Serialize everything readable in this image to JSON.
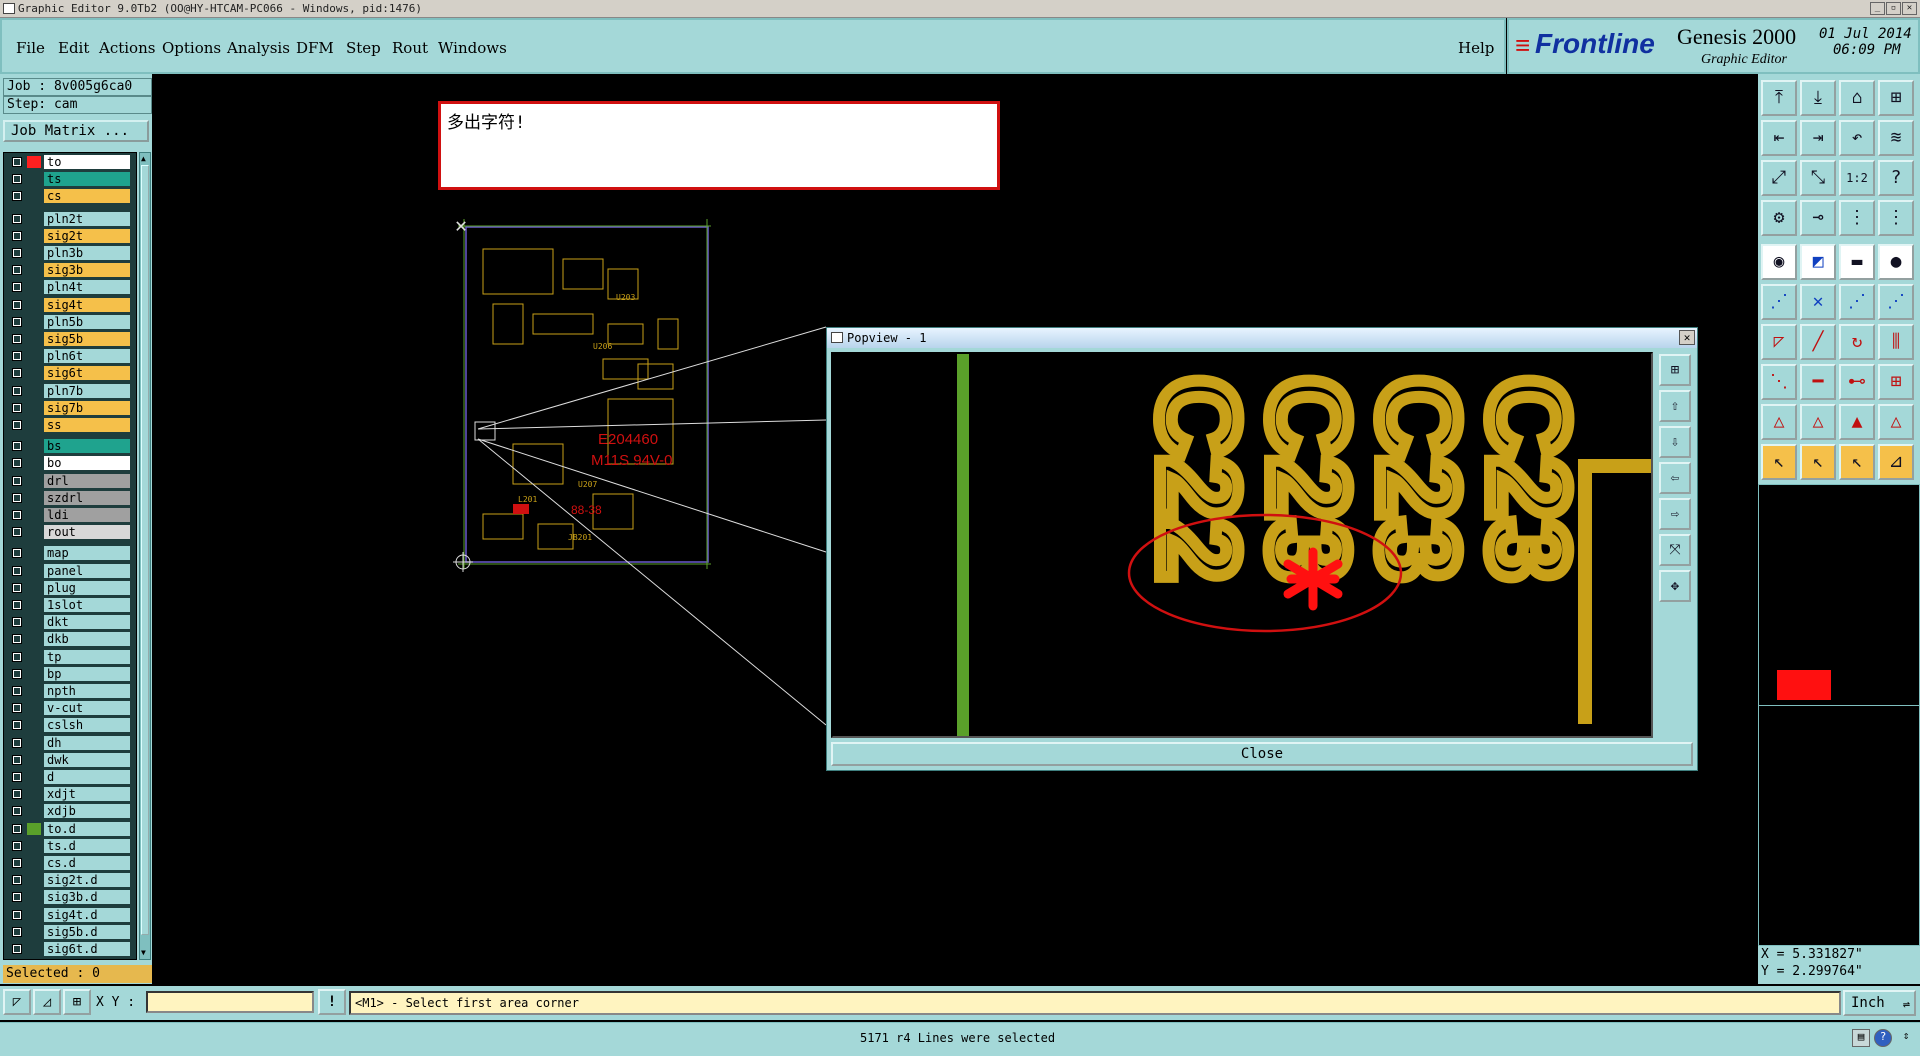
{
  "window": {
    "title": "Graphic Editor 9.0Tb2 (OO@HY-HTCAM-PC066 - Windows, pid:1476)",
    "controls": [
      "_",
      "▫",
      "✕"
    ]
  },
  "menu": {
    "items": [
      "File",
      "Edit",
      "Actions",
      "Options",
      "Analysis",
      "DFM",
      "Step",
      "Rout",
      "Windows"
    ],
    "help": "Help"
  },
  "brand": {
    "logo": "Frontline",
    "product": "Genesis 2000",
    "subtitle": "Graphic Editor",
    "date": "01 Jul 2014",
    "time": "06:09 PM"
  },
  "job": {
    "job_label": "Job : 8v005g6ca0",
    "step_label": "Step: cam",
    "matrix_button": "Job Matrix ..."
  },
  "layers": [
    {
      "name": "to",
      "color": "#ffffff",
      "swatch": "#ff2020",
      "sel": true,
      "flag": "⬋▦"
    },
    {
      "name": "ts",
      "color": "#1fa38e",
      "swatch": "",
      "flag": ""
    },
    {
      "name": "cs",
      "color": "#f5c04a",
      "swatch": "",
      "flag": ""
    },
    {
      "name": "pln2t",
      "color": "#a4d8d8",
      "swatch": "",
      "flag": ""
    },
    {
      "name": "sig2t",
      "color": "#f5c04a",
      "swatch": "",
      "flag": ""
    },
    {
      "name": "pln3b",
      "color": "#a4d8d8",
      "swatch": "",
      "flag": ""
    },
    {
      "name": "sig3b",
      "color": "#f5c04a",
      "swatch": "",
      "flag": ""
    },
    {
      "name": "pln4t",
      "color": "#a4d8d8",
      "swatch": "",
      "flag": ""
    },
    {
      "name": "sig4t",
      "color": "#f5c04a",
      "swatch": "",
      "flag": ""
    },
    {
      "name": "pln5b",
      "color": "#a4d8d8",
      "swatch": "",
      "flag": ""
    },
    {
      "name": "sig5b",
      "color": "#f5c04a",
      "swatch": "",
      "flag": ""
    },
    {
      "name": "pln6t",
      "color": "#a4d8d8",
      "swatch": "",
      "flag": ""
    },
    {
      "name": "sig6t",
      "color": "#f5c04a",
      "swatch": "",
      "flag": ""
    },
    {
      "name": "pln7b",
      "color": "#a4d8d8",
      "swatch": "",
      "flag": ""
    },
    {
      "name": "sig7b",
      "color": "#f5c04a",
      "swatch": "",
      "flag": ""
    },
    {
      "name": "ss",
      "color": "#f5c04a",
      "swatch": "",
      "flag": ""
    },
    {
      "name": "bs",
      "color": "#1fa38e",
      "swatch": "",
      "flag": ""
    },
    {
      "name": "bo",
      "color": "#ffffff",
      "swatch": "",
      "flag": "⬋"
    },
    {
      "name": "drl",
      "color": "#a0a0a0",
      "swatch": "",
      "flag": ""
    },
    {
      "name": "szdrl",
      "color": "#a0a0a0",
      "swatch": "",
      "flag": ""
    },
    {
      "name": "ldi",
      "color": "#a0a0a0",
      "swatch": "",
      "flag": ""
    },
    {
      "name": "rout",
      "color": "#d8d8d8",
      "swatch": "",
      "flag": ""
    },
    {
      "name": "map",
      "color": "#a4d8d8",
      "swatch": "",
      "flag": "⬋"
    },
    {
      "name": "panel",
      "color": "#a4d8d8",
      "swatch": "",
      "flag": ""
    },
    {
      "name": "plug",
      "color": "#a4d8d8",
      "swatch": "",
      "flag": ""
    },
    {
      "name": "1slot",
      "color": "#a4d8d8",
      "swatch": "",
      "flag": ""
    },
    {
      "name": "dkt",
      "color": "#a4d8d8",
      "swatch": "",
      "flag": ""
    },
    {
      "name": "dkb",
      "color": "#a4d8d8",
      "swatch": "",
      "flag": ""
    },
    {
      "name": "tp",
      "color": "#a4d8d8",
      "swatch": "",
      "flag": ""
    },
    {
      "name": "bp",
      "color": "#a4d8d8",
      "swatch": "",
      "flag": ""
    },
    {
      "name": "npth",
      "color": "#a4d8d8",
      "swatch": "",
      "flag": ""
    },
    {
      "name": "v-cut",
      "color": "#a4d8d8",
      "swatch": "",
      "flag": ""
    },
    {
      "name": "cslsh",
      "color": "#a4d8d8",
      "swatch": "",
      "flag": ""
    },
    {
      "name": "dh",
      "color": "#a4d8d8",
      "swatch": "",
      "flag": ""
    },
    {
      "name": "dwk",
      "color": "#a4d8d8",
      "swatch": "",
      "flag": ""
    },
    {
      "name": "d",
      "color": "#a4d8d8",
      "swatch": "",
      "flag": ""
    },
    {
      "name": "xdjt",
      "color": "#a4d8d8",
      "swatch": "",
      "flag": ""
    },
    {
      "name": "xdjb",
      "color": "#a4d8d8",
      "swatch": "",
      "flag": ""
    },
    {
      "name": "to.d",
      "color": "#a4d8d8",
      "swatch": "#5aa02a",
      "flag": "⬋"
    },
    {
      "name": "ts.d",
      "color": "#a4d8d8",
      "swatch": "",
      "flag": ""
    },
    {
      "name": "cs.d",
      "color": "#a4d8d8",
      "swatch": "",
      "flag": ""
    },
    {
      "name": "sig2t.d",
      "color": "#a4d8d8",
      "swatch": "",
      "flag": ""
    },
    {
      "name": "sig3b.d",
      "color": "#a4d8d8",
      "swatch": "",
      "flag": ""
    },
    {
      "name": "sig4t.d",
      "color": "#a4d8d8",
      "swatch": "",
      "flag": ""
    },
    {
      "name": "sig5b.d",
      "color": "#a4d8d8",
      "swatch": "",
      "flag": ""
    },
    {
      "name": "sig6t.d",
      "color": "#a4d8d8",
      "swatch": "",
      "flag": ""
    }
  ],
  "selected_label": "Selected : 0",
  "message": {
    "text": "多出字符!"
  },
  "board": {
    "marks": [
      "E204460",
      "M11S 94V-0",
      "88-38",
      "U203",
      "U206",
      "U207",
      "L201",
      "JB201"
    ]
  },
  "popview": {
    "title": "Popview - 1",
    "close_label": "Close",
    "close_icon": "✕",
    "labels": [
      "C22",
      "C23",
      "C23",
      "C23"
    ]
  },
  "coords": {
    "x": "X = 5.331827\"",
    "y": "Y = 2.299764\""
  },
  "cmd": {
    "xy_label": "X Y :",
    "prompt": "<M1> - Select first area corner",
    "unit": "Inch"
  },
  "status": {
    "text": "5171 r4 Lines were selected"
  }
}
